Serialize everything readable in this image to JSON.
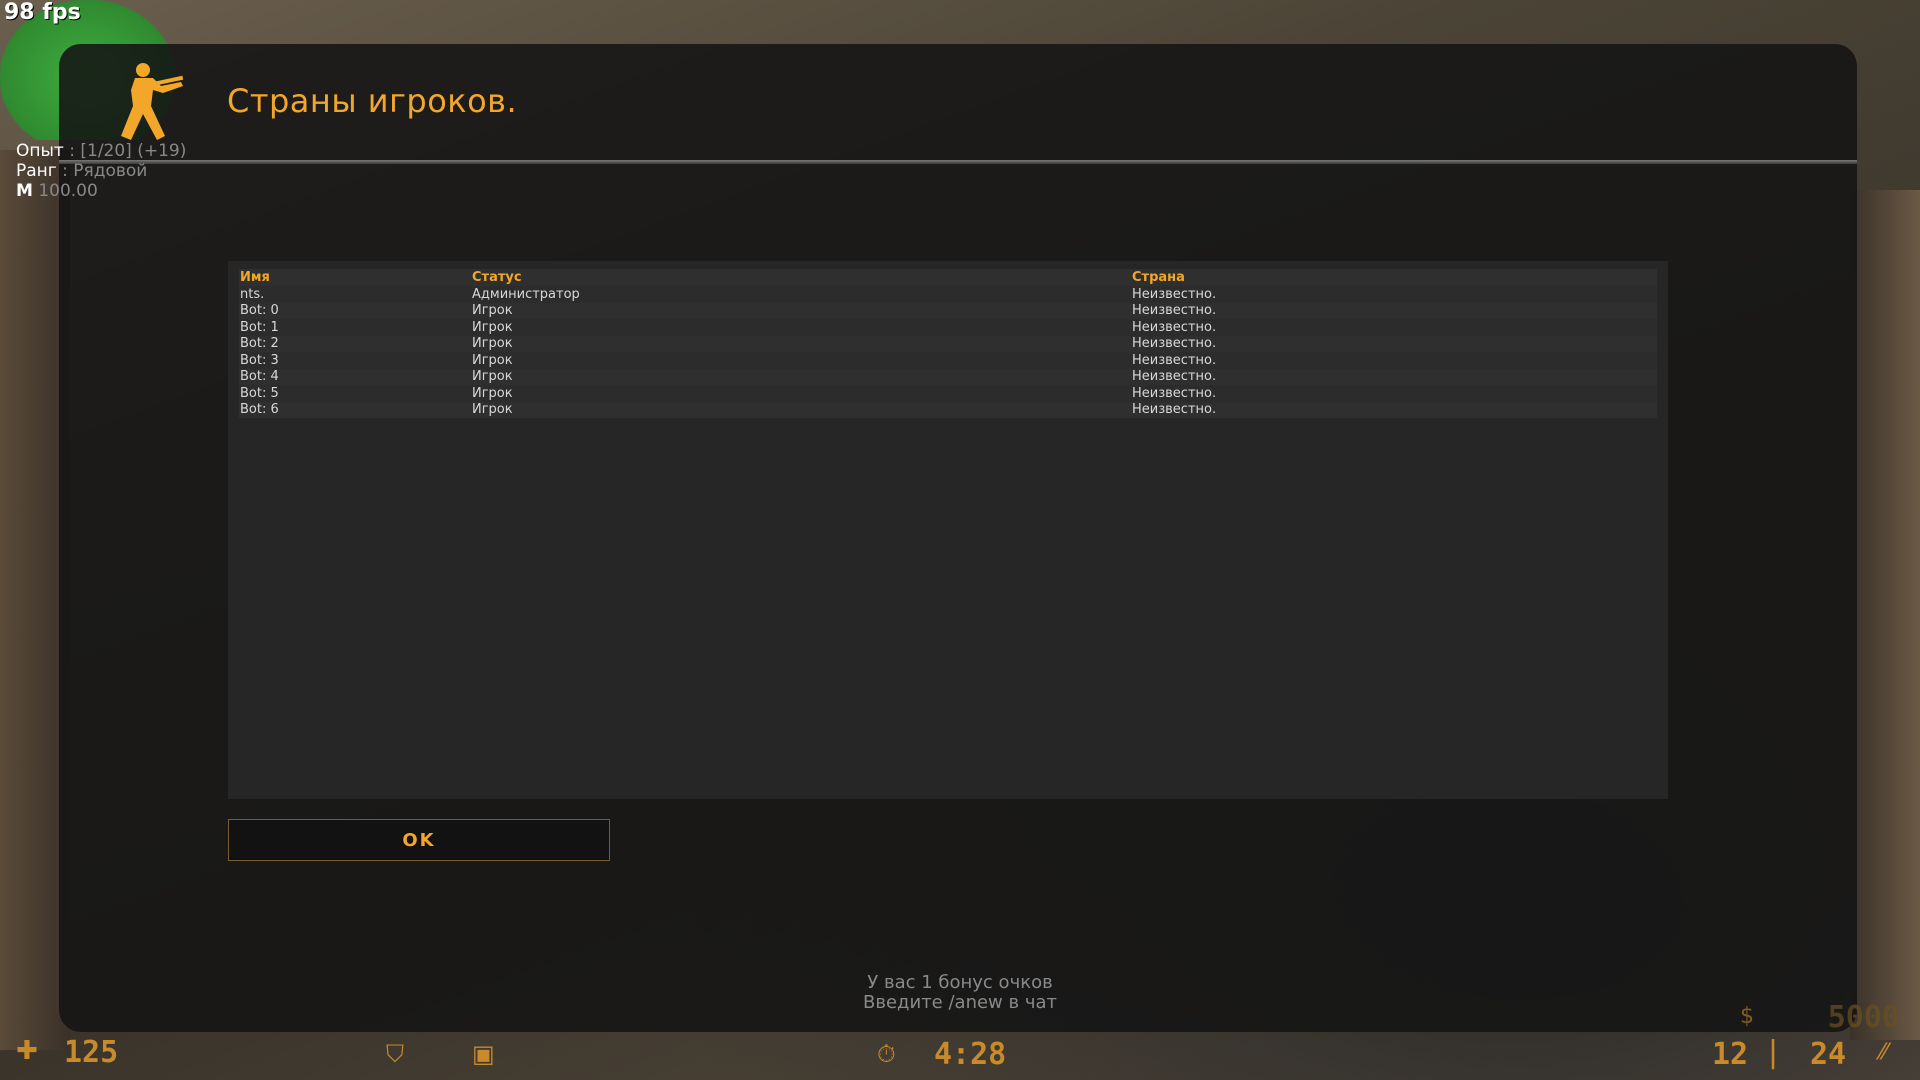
{
  "hud": {
    "fps": "98 fps",
    "health": "125",
    "time": "4:28",
    "ammo_clip": "12",
    "ammo_reserve": "24",
    "money": "5000"
  },
  "player_info": {
    "xp_label": "Опыт",
    "xp_value": ": [1/20] (+19)",
    "rank_label": "Ранг",
    "rank_value": ": Рядовой",
    "money_label": "М",
    "money_value": "100.00"
  },
  "dialog": {
    "title": "Страны игроков.",
    "ok_label": "OK"
  },
  "table": {
    "headers": [
      "Имя",
      "Статус",
      "Страна"
    ],
    "rows": [
      [
        "nts.",
        "Администратор",
        "Неизвестно."
      ],
      [
        "Bot: 0",
        "Игрок",
        "Неизвестно."
      ],
      [
        "Bot: 1",
        "Игрок",
        "Неизвестно."
      ],
      [
        "Bot: 2",
        "Игрок",
        "Неизвестно."
      ],
      [
        "Bot: 3",
        "Игрок",
        "Неизвестно."
      ],
      [
        "Bot: 4",
        "Игрок",
        "Неизвестно."
      ],
      [
        "Bot: 5",
        "Игрок",
        "Неизвестно."
      ],
      [
        "Bot: 6",
        "Игрок",
        "Неизвестно."
      ]
    ]
  },
  "bonus": {
    "line1": "У вас 1 бонус очков",
    "line2": "Введите /anew в чат"
  },
  "colors": {
    "accent": "#f3a72a",
    "panel": "#141414",
    "table_bg": "#262626"
  },
  "icons": [
    "counter-terrorist-logo-icon",
    "health-cross-icon",
    "armor-shield-icon",
    "armor-box-icon",
    "timer-icon",
    "money-icon"
  ]
}
